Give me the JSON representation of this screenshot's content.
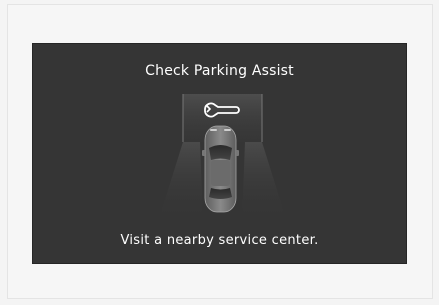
{
  "dialog": {
    "title": "Check Parking Assist",
    "message": "Visit a nearby service center."
  },
  "icons": {
    "warning": "wrench-icon",
    "vehicle": "car-top-view-icon"
  },
  "colors": {
    "display_background": "#353535",
    "text": "#ffffff",
    "page_background": "#f4f4f4"
  }
}
